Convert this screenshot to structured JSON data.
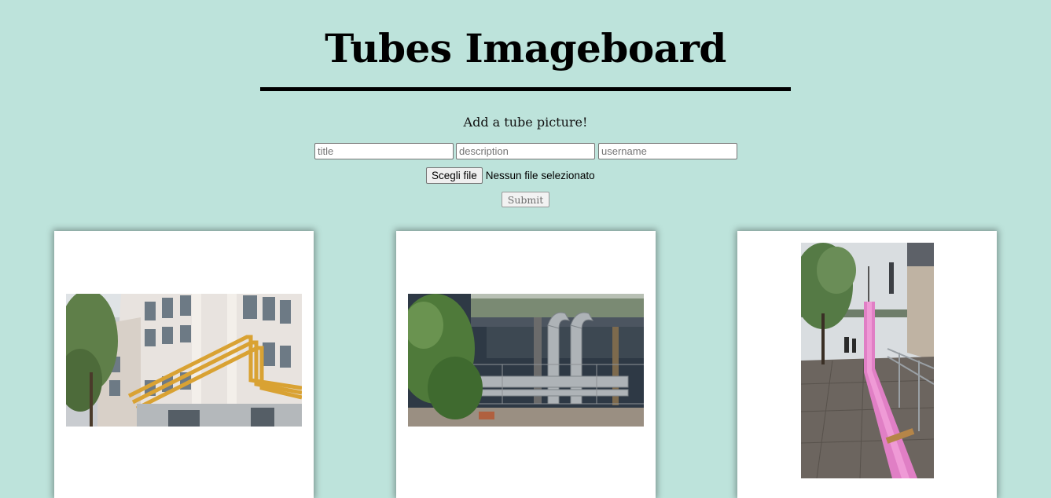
{
  "header": {
    "title": "Tubes Imageboard"
  },
  "upload_form": {
    "heading": "Add a tube picture!",
    "title_placeholder": "title",
    "description_placeholder": "description",
    "username_placeholder": "username",
    "title_value": "",
    "description_value": "",
    "username_value": "",
    "file_button_label": "Scegli file",
    "file_status": "Nessun file selezionato",
    "submit_label": "Submit"
  },
  "colors": {
    "background": "#bde3db",
    "card": "#ffffff",
    "divider": "#000000"
  },
  "gallery": {
    "images": [
      {
        "subject": "building with yellow pipes"
      },
      {
        "subject": "silver pipes under bridge"
      },
      {
        "subject": "pink pipe along sidewalk"
      }
    ]
  }
}
